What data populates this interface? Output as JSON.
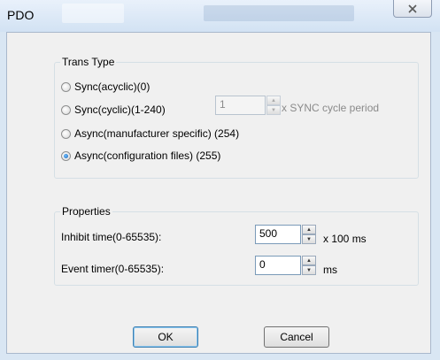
{
  "window": {
    "title": "PDO"
  },
  "trans_type": {
    "legend": "Trans Type",
    "options": [
      {
        "label": "Sync(acyclic)(0)",
        "checked": false
      },
      {
        "label": "Sync(cyclic)(1-240)",
        "checked": false
      },
      {
        "label": "Async(manufacturer specific) (254)",
        "checked": false
      },
      {
        "label": "Async(configuration files) (255)",
        "checked": true
      }
    ],
    "sync_cycle": {
      "value": "1",
      "unit": "x SYNC cycle period",
      "enabled": false
    }
  },
  "properties": {
    "legend": "Properties",
    "inhibit": {
      "label": "Inhibit time(0-65535):",
      "value": "500",
      "unit": "x 100 ms"
    },
    "event": {
      "label": "Event timer(0-65535):",
      "value": "0",
      "unit": "ms"
    }
  },
  "buttons": {
    "ok": "OK",
    "cancel": "Cancel"
  }
}
